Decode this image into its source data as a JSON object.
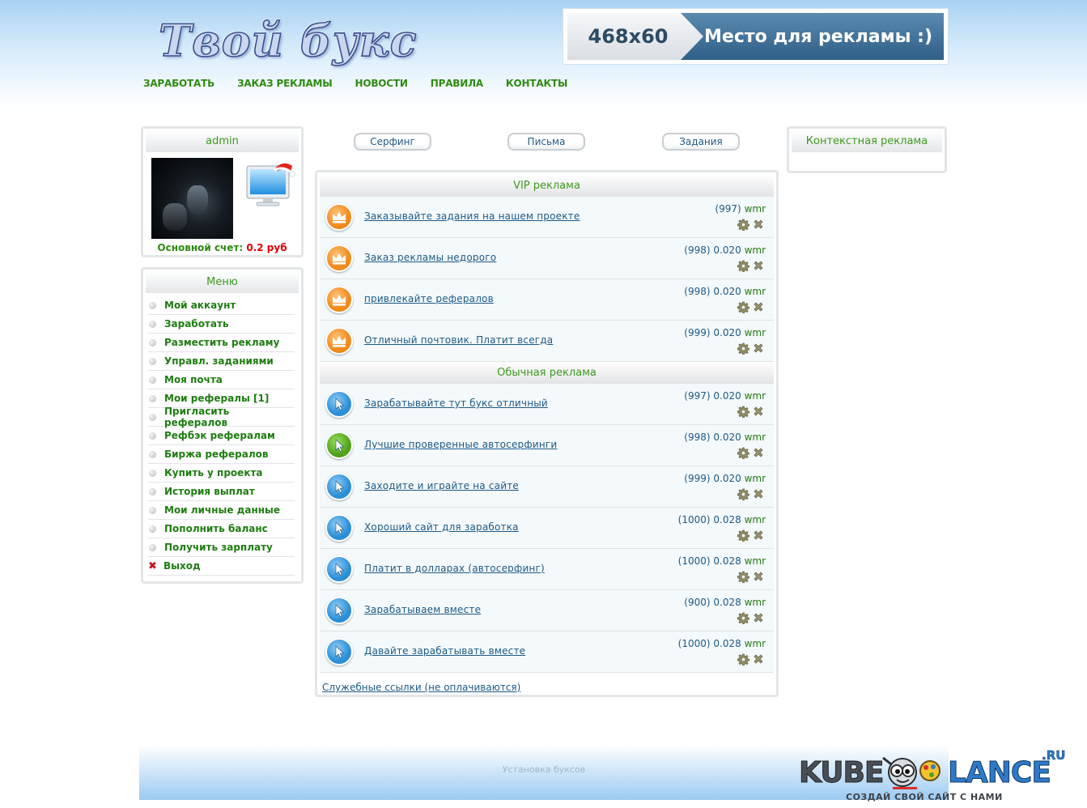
{
  "header": {
    "logo_text": "Твой букс",
    "banner_size": "468x60",
    "banner_text": "Место для рекламы :)"
  },
  "nav": [
    "ЗАРАБОТАТЬ",
    "ЗАКАЗ РЕКЛАМЫ",
    "НОВОСТИ",
    "ПРАВИЛА",
    "КОНТАКТЫ"
  ],
  "user": {
    "name": "admin",
    "balance_label": "Основной счет:",
    "balance_value": "0.2 руб"
  },
  "menu": {
    "title": "Меню",
    "items": [
      "Мой аккаунт",
      "Заработать",
      "Разместить рекламу",
      "Управл. заданиями",
      "Моя почта",
      "Мои рефералы [1]",
      "Пригласить рефералов",
      "Рефбэк рефералам",
      "Биржа рефералов",
      "Купить у проекта",
      "История выплат",
      "Мои личные данные",
      "Пополнить баланс",
      "Получить зарплату",
      "Выход"
    ]
  },
  "tabs": [
    "Серфинг",
    "Письма",
    "Задания"
  ],
  "vip": {
    "title": "VIP реклама",
    "rows": [
      {
        "title": "Заказывайте задания на нашем проекте",
        "count": "(997)",
        "price": "",
        "unit": "wmr"
      },
      {
        "title": "Заказ рекламы недорого",
        "count": "(998)",
        "price": "0.020",
        "unit": "wmr"
      },
      {
        "title": "привлекайте рефералов",
        "count": "(998)",
        "price": "0.020",
        "unit": "wmr"
      },
      {
        "title": "Отличный почтовик. Платит всегда",
        "count": "(999)",
        "price": "0.020",
        "unit": "wmr"
      }
    ]
  },
  "regular": {
    "title": "Обычная реклама",
    "rows": [
      {
        "title": "Зарабатывайте тут букс отличный",
        "count": "(997)",
        "price": "0.020",
        "unit": "wmr",
        "icon": "blue"
      },
      {
        "title": "Лучшие проверенные автосерфинги",
        "count": "(998)",
        "price": "0.020",
        "unit": "wmr",
        "icon": "green"
      },
      {
        "title": "Заходите и играйте на сайте",
        "count": "(999)",
        "price": "0.020",
        "unit": "wmr",
        "icon": "blue"
      },
      {
        "title": "Хороший сайт для заработка",
        "count": "(1000)",
        "price": "0.028",
        "unit": "wmr",
        "icon": "blue"
      },
      {
        "title": "Платит в долларах (автосерфинг)",
        "count": "(1000)",
        "price": "0.028",
        "unit": "wmr",
        "icon": "blue"
      },
      {
        "title": "Зарабатываем вместе",
        "count": "(900)",
        "price": "0.028",
        "unit": "wmr",
        "icon": "blue"
      },
      {
        "title": "Давайте зарабатывать вместе",
        "count": "(1000)",
        "price": "0.028",
        "unit": "wmr",
        "icon": "blue"
      }
    ]
  },
  "service_link": "Служебные ссылки (не оплачиваются)",
  "context": {
    "title": "Контекстная реклама"
  },
  "footer": {
    "text": "Установка буксов",
    "watermark_left": "KUBE",
    "watermark_right": "LANCE",
    "watermark_tld": ".RU",
    "watermark_slogan": "СОЗДАЙ СВОЙ САЙТ С НАМИ"
  },
  "colors": {
    "accent_green": "#2e8a12",
    "link_blue": "#1d5a86",
    "balance_red": "#e00000",
    "vip_icon": "#f08a1c",
    "regular_icon_blue": "#2b8fd6",
    "regular_icon_green": "#4fa21c"
  },
  "icons": {
    "vip": "crown-icon",
    "regular": "cursor-arrow-icon",
    "settings": "gear-icon",
    "delete": "close-icon"
  }
}
